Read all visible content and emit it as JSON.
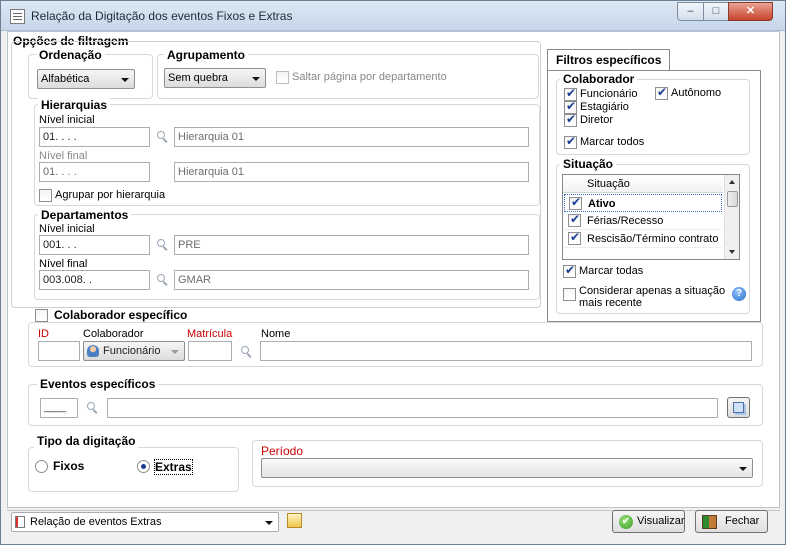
{
  "window": {
    "title": "Relação da Digitação dos eventos Fixos e Extras",
    "min": "–",
    "max": "□",
    "close": "✕"
  },
  "filtros": {
    "title": "Opções de filtragem",
    "ordenacao": {
      "label": "Ordenação",
      "value": "Alfabética"
    },
    "agrupamento": {
      "label": "Agrupamento",
      "value": "Sem quebra",
      "saltar": "Saltar página por departamento"
    },
    "hierarquias": {
      "label": "Hierarquias",
      "inicial_label": "Nível inicial",
      "inicial_code": "01.    .    .    .",
      "inicial_name": "Hierarquia 01",
      "final_label": "Nível final",
      "final_code": "01.    .    .    .",
      "final_name": "Hierarquia 01",
      "agrupar": "Agrupar por hierarquia"
    },
    "departamentos": {
      "label": "Departamentos",
      "inicial_label": "Nível inicial",
      "inicial_code": "001.    .    .",
      "inicial_name": "PRE",
      "final_label": "Nível final",
      "final_code": "003.008.    .",
      "final_name": "GMAR"
    }
  },
  "especificos": {
    "tab": "Filtros específicos",
    "colaborador": {
      "label": "Colaborador",
      "funcionario": "Funcionário",
      "autonomo": "Autônomo",
      "estagiario": "Estagiário",
      "diretor": "Diretor",
      "marcar": "Marcar todos"
    },
    "situacao": {
      "label": "Situação",
      "header": "Situação",
      "rows": [
        "Ativo",
        "Férias/Recesso",
        "Rescisão/Término contrato"
      ],
      "marcar": "Marcar todas",
      "considerar": "Considerar apenas a situação mais recente"
    }
  },
  "colab_esp": {
    "label": "Colaborador específico",
    "id": "ID",
    "colaborador": "Colaborador",
    "tipo": "Funcionário",
    "matricula": "Matrícula",
    "nome": "Nome"
  },
  "eventos": {
    "label": "Eventos específicos",
    "code": "____"
  },
  "tipo": {
    "label": "Tipo da digitação",
    "fixos": "Fixos",
    "extras": "Extras"
  },
  "periodo": {
    "label": "Período"
  },
  "footer": {
    "report": "Relação de eventos Extras",
    "visualizar": "Visualizar",
    "fechar": "Fechar"
  },
  "colors": {
    "accent": "#1c3f94",
    "required": "#cc0000"
  }
}
